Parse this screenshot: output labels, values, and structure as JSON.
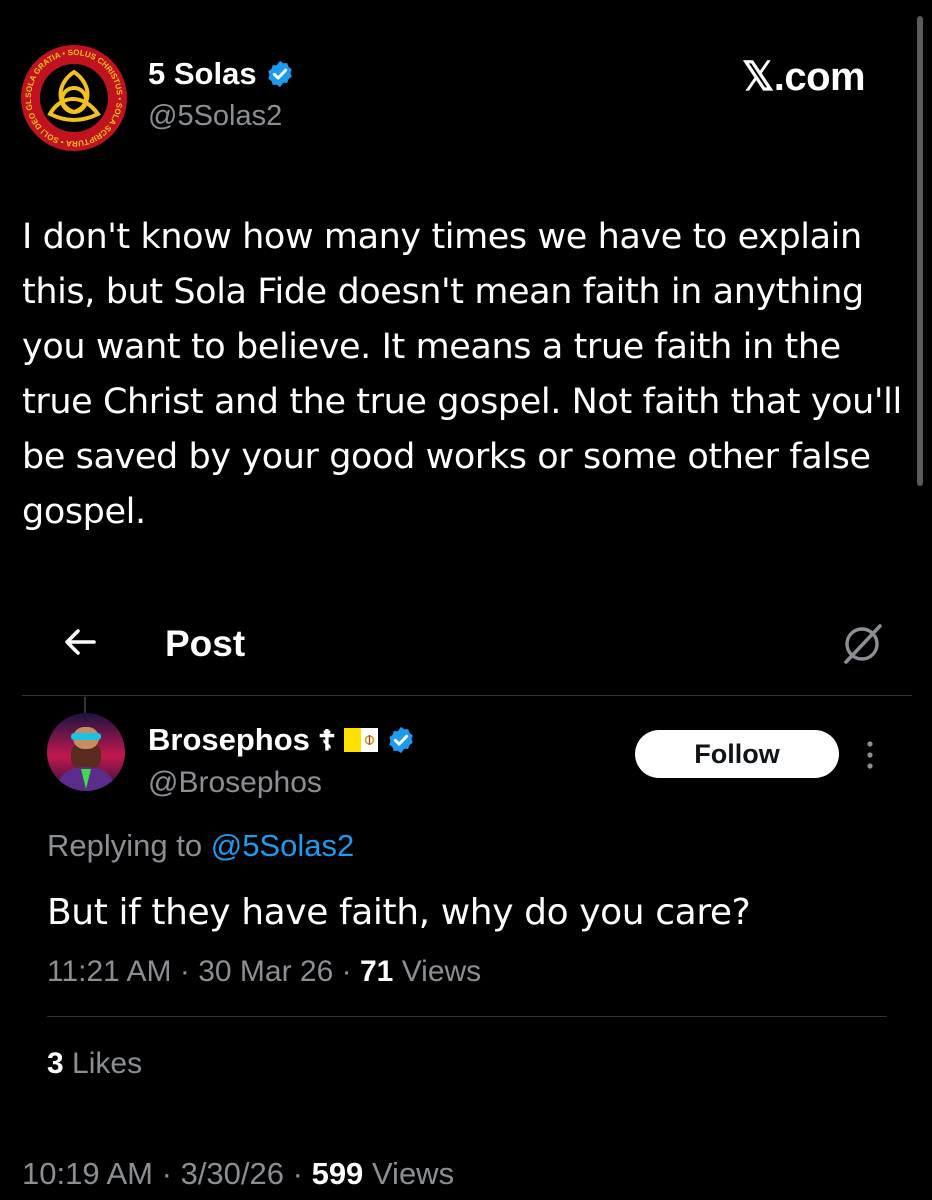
{
  "page": {
    "brand": "𝕏.com"
  },
  "outer_tweet": {
    "display_name": "5 Solas",
    "handle": "@5Solas2",
    "avatar_ring_text": "SOLA GRATIA • SOLUS CHRISTUS • SOLA SCRIPTURA • SOLI DEO GLORIA • SOLA FIDE •",
    "text": "I don't know how many times we have to explain this, but Sola Fide doesn't mean faith in anything you want to believe. It means a true faith in the true Christ and the true gospel. Not faith that you'll be saved by your good works or some other false gospel.",
    "time": "10:19 AM",
    "date": "3/30/26",
    "views_count": "599",
    "views_label": "Views",
    "sep": "·"
  },
  "embedded": {
    "nav_title": "Post",
    "back_icon": "arrow-left-icon",
    "grok_icon": "grok-icon",
    "reply": {
      "display_name": "Brosephos",
      "name_symbol": "☦",
      "handle": "@Brosephos",
      "follow_label": "Follow",
      "replying_prefix": "Replying to",
      "replying_handle": "@5Solas2",
      "text": "But if they have faith, why do you care?",
      "time": "11:21 AM",
      "date": "30 Mar 26",
      "views_count": "71",
      "views_label": "Views",
      "sep": "·",
      "likes_count": "3",
      "likes_label": "Likes"
    }
  },
  "colors": {
    "background": "#000000",
    "text": "#ffffff",
    "muted": "#8b8f94",
    "accent": "#1d9bf0",
    "avatar_gold": "#f2c21b",
    "avatar_red": "#c1121f"
  }
}
